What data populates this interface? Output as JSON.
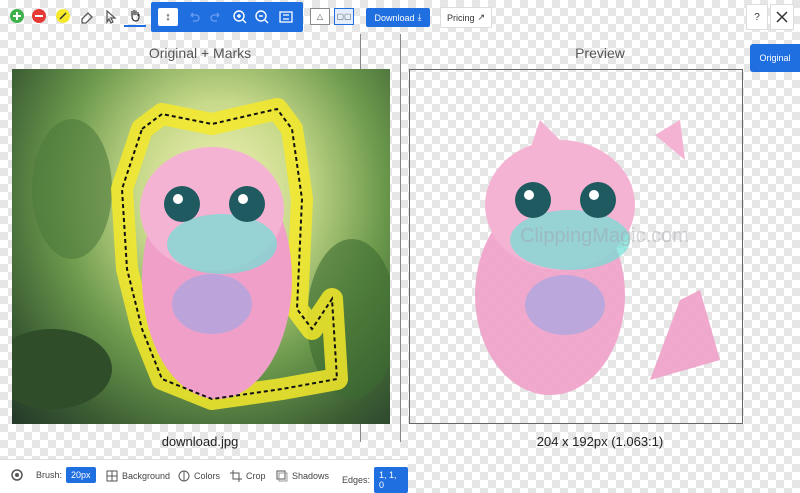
{
  "toolbar": {
    "select_value": "↕",
    "download_label": "Download",
    "pricing_label": "Pricing",
    "help_label": "?",
    "icons": [
      "add-green-icon",
      "remove-red-icon",
      "pen-icon",
      "eraser-icon",
      "select-icon",
      "hand-icon",
      "zoom-in-icon",
      "zoom-out-icon",
      "fit-icon",
      "view-single-icon",
      "view-split-icon",
      "close-icon"
    ]
  },
  "side_button": {
    "original_label": "Original"
  },
  "left_pane": {
    "title": "Original + Marks",
    "filename": "download.jpg"
  },
  "right_pane": {
    "title": "Preview",
    "dimensions": "204 x 192px (1.063:1)"
  },
  "bottom_bar": {
    "brush_label": "Brush:",
    "brush_value": "20px",
    "background_label": "Background",
    "colors_label": "Colors",
    "crop_label": "Crop",
    "shadows_label": "Shadows",
    "edges_label": "Edges:",
    "edges_value": "1, 1, 0"
  },
  "watermark": "ClippingMagic.com",
  "colors": {
    "accent": "#1f6fe0",
    "keep": "#3cb34a",
    "remove": "#e53935",
    "mark": "#f5e92a"
  }
}
